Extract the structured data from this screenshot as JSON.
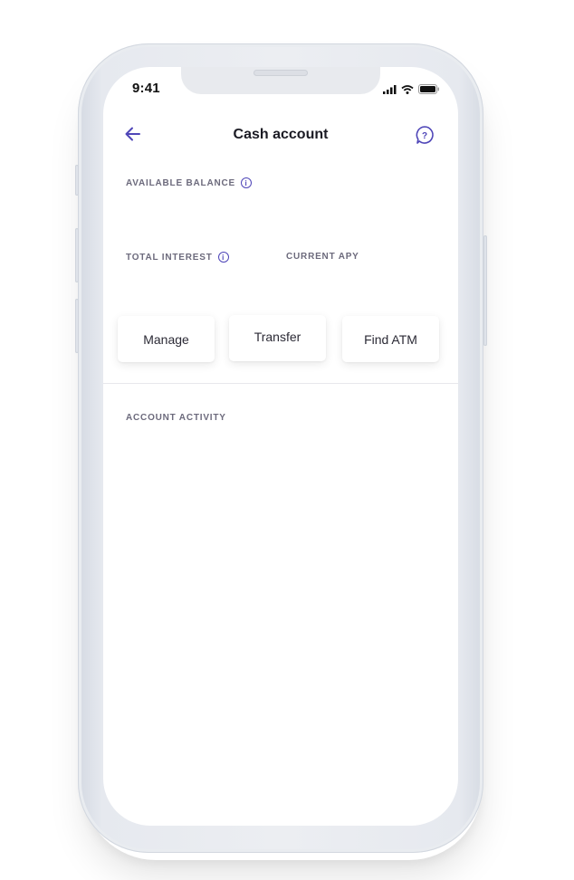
{
  "status_bar": {
    "time": "9:41",
    "icons": [
      "signal-icon",
      "wifi-icon",
      "battery-icon"
    ]
  },
  "nav": {
    "back_icon": "arrow-left-icon",
    "title": "Cash account",
    "help_icon": "question-bubble-icon"
  },
  "balance": {
    "available_label": "AVAILABLE BALANCE",
    "info_icon": "info-icon",
    "info_glyph": "i"
  },
  "stats": {
    "total_interest_label": "TOTAL INTEREST",
    "current_apy_label": "CURRENT APY"
  },
  "actions": [
    {
      "label": "Manage"
    },
    {
      "label": "Transfer"
    },
    {
      "label": "Find ATM"
    }
  ],
  "activity": {
    "label": "ACCOUNT ACTIVITY"
  },
  "colors": {
    "accent": "#4f46b8",
    "label_text": "#6c6a7c",
    "title_text": "#1b1b24"
  }
}
